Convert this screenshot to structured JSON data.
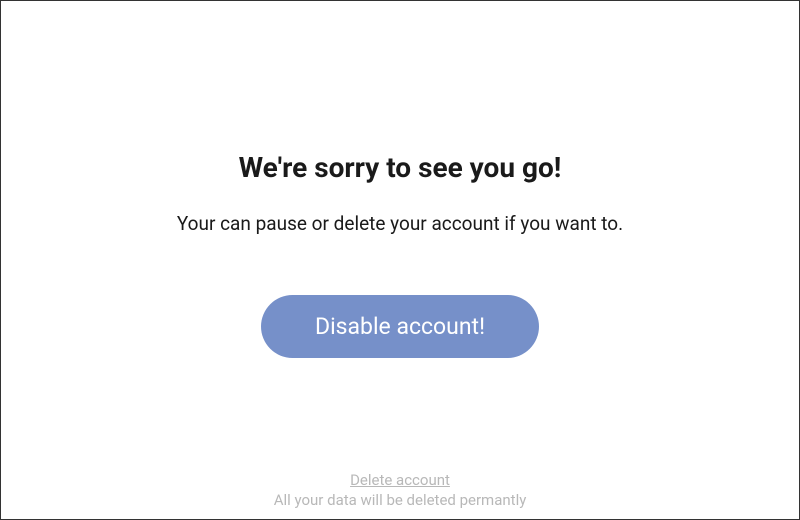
{
  "heading": "We're sorry to see you go!",
  "subtext": "Your can pause or delete your account if you want to.",
  "primary_button": "Disable account!",
  "footer": {
    "delete_link": "Delete account",
    "note": "All your data will be deleted permantly"
  }
}
